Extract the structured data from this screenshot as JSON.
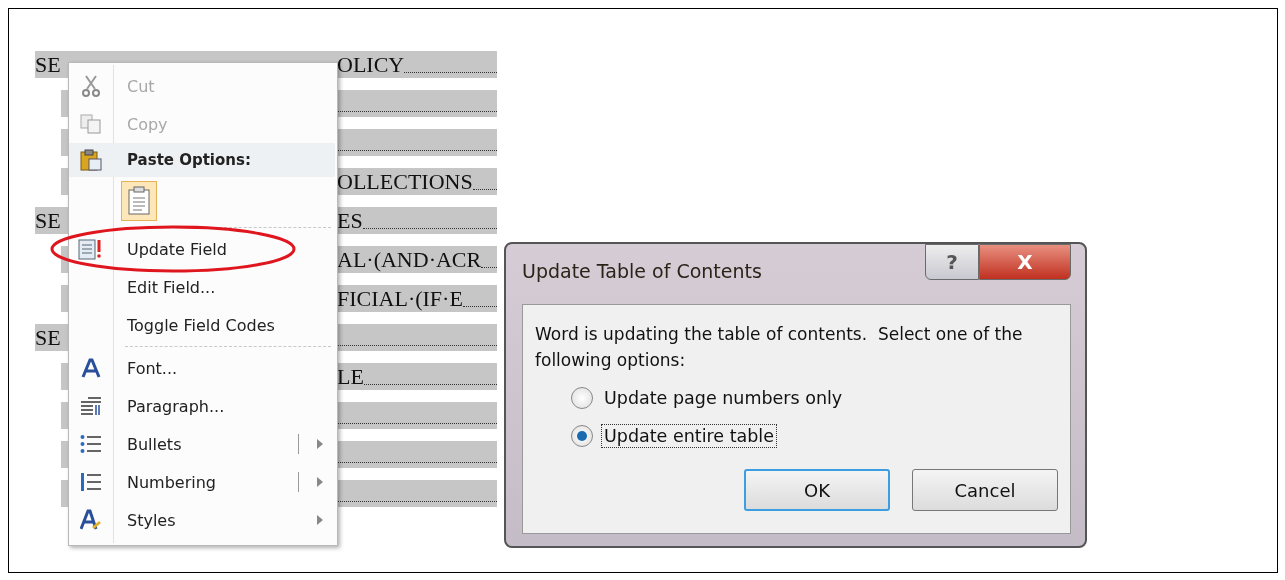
{
  "document": {
    "toc_rows": [
      {
        "kind": "section",
        "left": "SE",
        "right": "OLICY"
      },
      {
        "kind": "item"
      },
      {
        "kind": "item"
      },
      {
        "kind": "item",
        "right": "OLLECTIONS"
      },
      {
        "kind": "section",
        "left": "SE",
        "right": "ES"
      },
      {
        "kind": "item",
        "right": "AL·(AND·ACR"
      },
      {
        "kind": "item",
        "right": "FICIAL·(IF·E"
      },
      {
        "kind": "section",
        "left": "SE"
      },
      {
        "kind": "item",
        "right": "LE"
      },
      {
        "kind": "item"
      },
      {
        "kind": "item"
      },
      {
        "kind": "item"
      }
    ]
  },
  "context_menu": {
    "items": [
      {
        "kind": "item",
        "label": "Cut",
        "disabled": true,
        "has_submenu": false
      },
      {
        "kind": "item",
        "label": "Copy",
        "disabled": true,
        "has_submenu": false
      },
      {
        "kind": "header",
        "label": "Paste Options:"
      },
      {
        "kind": "paste"
      },
      {
        "kind": "separator"
      },
      {
        "kind": "item",
        "label": "Update Field",
        "disabled": false,
        "has_submenu": false,
        "circled": true
      },
      {
        "kind": "item",
        "label": "Edit Field...",
        "disabled": false,
        "has_submenu": false
      },
      {
        "kind": "item",
        "label": "Toggle Field Codes",
        "disabled": false,
        "has_submenu": false
      },
      {
        "kind": "separator"
      },
      {
        "kind": "item",
        "label": "Font...",
        "disabled": false,
        "has_submenu": false
      },
      {
        "kind": "item",
        "label": "Paragraph...",
        "disabled": false,
        "has_submenu": false
      },
      {
        "kind": "item",
        "label": "Bullets",
        "disabled": false,
        "has_submenu": true,
        "split_button": true
      },
      {
        "kind": "item",
        "label": "Numbering",
        "disabled": false,
        "has_submenu": true,
        "split_button": true
      },
      {
        "kind": "item",
        "label": "Styles",
        "disabled": false,
        "has_submenu": true,
        "split_button": false
      }
    ]
  },
  "dialog": {
    "title": "Update Table of Contents",
    "help_button": "?",
    "close_button": "X",
    "message": "Word is updating the table of contents.  Select one of the following options:",
    "options": [
      {
        "label": "Update page numbers only",
        "selected": false
      },
      {
        "label": "Update entire table",
        "selected": true
      }
    ],
    "buttons": [
      {
        "label": "OK",
        "default": true
      },
      {
        "label": "Cancel",
        "default": false
      }
    ]
  }
}
